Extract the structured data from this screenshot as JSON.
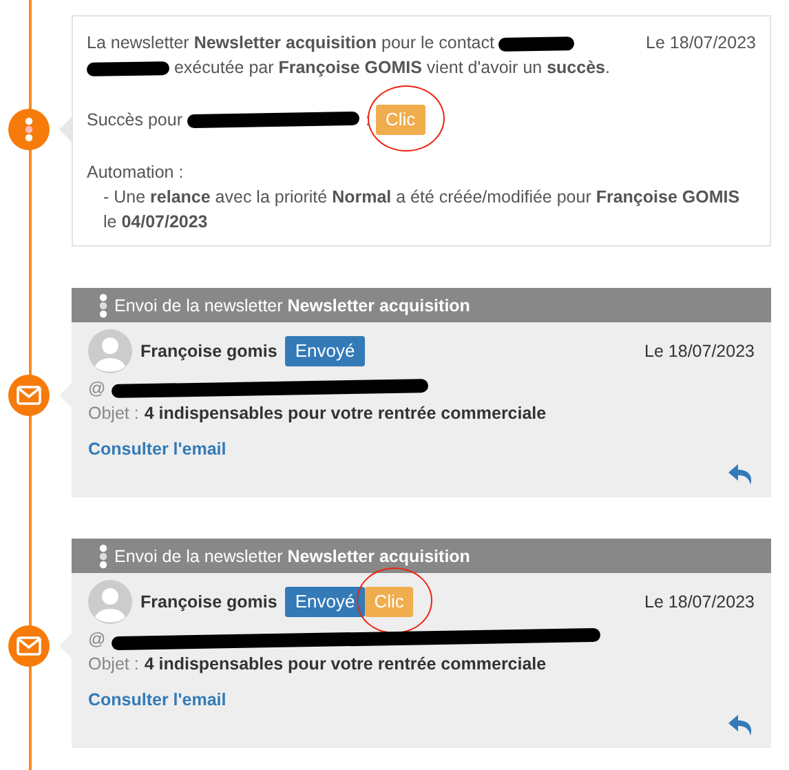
{
  "events": [
    {
      "kind": "note",
      "date": "Le 18/07/2023",
      "intro_before": "La newsletter **Newsletter acquisition** pour le contact",
      "intro_after": "exécutée par **Françoise GOMIS** vient d'avoir un **succès**.",
      "success_label": "Succès pour",
      "success_sep": ":",
      "badge": {
        "label": "Clic",
        "kind": "click",
        "circled": true
      },
      "automation_title": "Automation :",
      "automation_line": "- Une **relance** avec la priorité **Normal** a été créée/modifiée pour **Françoise GOMIS** le **04/07/2023**"
    },
    {
      "kind": "email",
      "header": "Envoi de la newsletter **Newsletter acquisition**",
      "author": "Françoise gomis",
      "date": "Le 18/07/2023",
      "badges": [
        {
          "label": "Envoyé",
          "kind": "sent",
          "circled": false
        }
      ],
      "at": "@",
      "subject_label": "Objet :",
      "subject": "4 indispensables pour votre rentrée commerciale",
      "link": "Consulter l'email"
    },
    {
      "kind": "email",
      "header": "Envoi de la newsletter **Newsletter acquisition**",
      "author": "Françoise gomis",
      "date": "Le 18/07/2023",
      "badges": [
        {
          "label": "Envoyé",
          "kind": "sent",
          "circled": false
        },
        {
          "label": "Clic",
          "kind": "click",
          "circled": true
        }
      ],
      "at": "@",
      "subject_label": "Objet :",
      "subject": "4 indispensables pour votre rentrée commerciale",
      "link": "Consulter l'email"
    }
  ]
}
